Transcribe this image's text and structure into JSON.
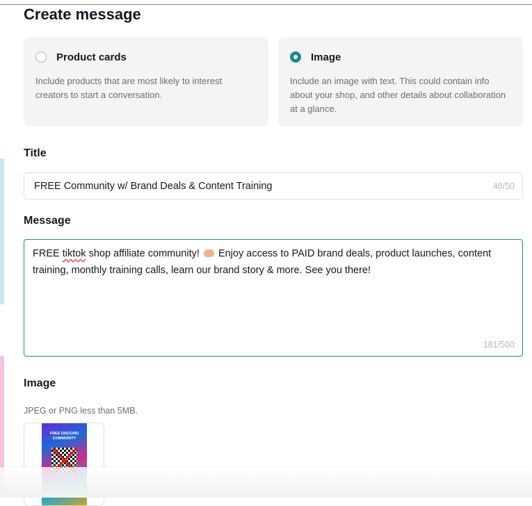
{
  "page": {
    "title": "Create message"
  },
  "message_type": {
    "options": [
      {
        "label": "Product cards",
        "description": "Include products that are most likely to interest creators to start a conversation.",
        "selected": false
      },
      {
        "label": "Image",
        "description": "Include an image with text. This could contain info about your shop, and other details about collaboration at a glance.",
        "selected": true
      }
    ]
  },
  "title_field": {
    "label": "Title",
    "value": "FREE Community w/ Brand Deals & Content Training",
    "counter": "48/50"
  },
  "message_field": {
    "label": "Message",
    "value_before": "FREE ",
    "value_misspelled": "tiktok",
    "value_after": " shop affiliate community! ",
    "value_tail": " Enjoy access to PAID brand deals, product launches, content training, monthly training calls, learn our brand story & more. See you there!",
    "emoji_icon": "handshake-emoji-icon",
    "counter": "181/500"
  },
  "image_field": {
    "label": "Image",
    "hint": "JPEG or PNG less than 5MB.",
    "poster_text": "FREE DISCORD COMMUNITY"
  },
  "colors": {
    "accent": "#1a8b88",
    "card_bg": "#f4f4f5",
    "muted_text": "#6b6d75"
  }
}
